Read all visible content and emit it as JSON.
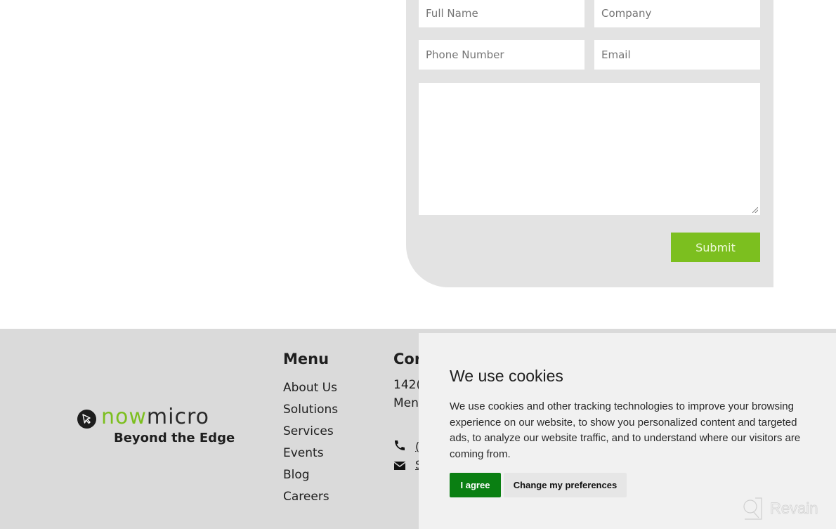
{
  "contact_form": {
    "fields": {
      "full_name": {
        "placeholder": "Full Name",
        "value": ""
      },
      "company": {
        "placeholder": "Company",
        "value": ""
      },
      "phone": {
        "placeholder": "Phone Number",
        "value": ""
      },
      "email": {
        "placeholder": "Email",
        "value": ""
      },
      "message": {
        "placeholder": "",
        "value": ""
      }
    },
    "submit_label": "Submit",
    "accent_color": "#7cbf1f"
  },
  "footer": {
    "logo": {
      "word_green": "now",
      "word_dark": "micro",
      "icon": "cursor-arrow-icon"
    },
    "tagline": "Beyond the Edge",
    "menu": {
      "title": "Menu",
      "items": [
        "About Us",
        "Solutions",
        "Services",
        "Events",
        "Blog",
        "Careers"
      ]
    },
    "contact": {
      "title_visible": "Cor",
      "address_line1_visible": "142(",
      "address_line2_visible": "Men",
      "phone_icon": "phone-icon",
      "email_icon": "envelope-icon",
      "phone_visible": "(",
      "email_visible": "S"
    }
  },
  "cookie_banner": {
    "title": "We use cookies",
    "body": "We use cookies and other tracking technologies to improve your browsing experience on our website, to show you personalized content and targeted ads, to analyze our website traffic, and to understand where our visitors are coming from.",
    "agree_label": "I agree",
    "preferences_label": "Change my preferences",
    "agree_color": "#0a7f12"
  },
  "watermark": {
    "text": "Revain"
  }
}
